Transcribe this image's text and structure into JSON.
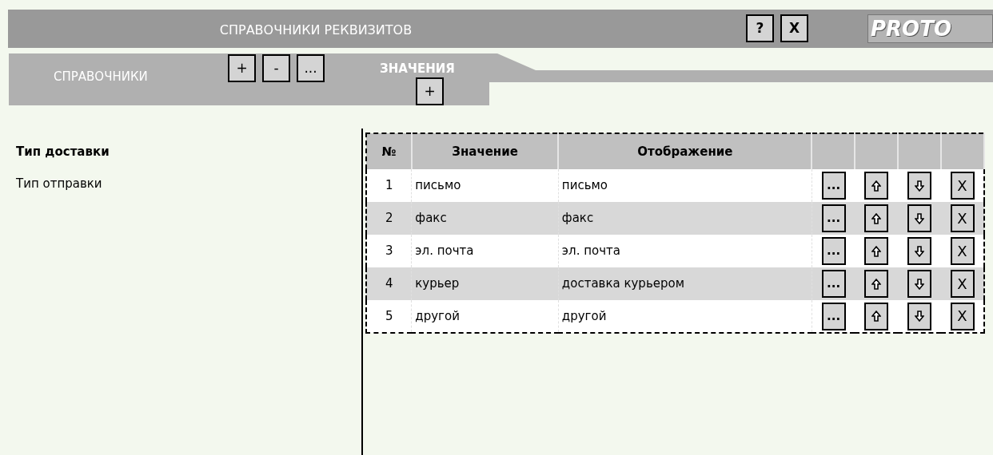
{
  "window": {
    "title": "СПРАВОЧНИКИ РЕКВИЗИТОВ",
    "buttons": [
      "?",
      "X"
    ],
    "logo": "PROTO"
  },
  "tabs": [
    {
      "label": "СПРАВОЧНИКИ",
      "selected": false,
      "buttons": [
        "+",
        "-",
        "..."
      ]
    },
    {
      "label": "ЗНАЧЕНИЯ",
      "selected": true,
      "buttons": [
        "+"
      ]
    }
  ],
  "sidebar": {
    "items": [
      {
        "label": "Тип доставки",
        "selected": true
      },
      {
        "label": "Тип отправки",
        "selected": false
      }
    ]
  },
  "table": {
    "columns": [
      "№",
      "Значение",
      "Отображение"
    ],
    "rows": [
      {
        "cells": [
          "1",
          "письмо",
          "письмо"
        ],
        "buttons": [
          "...",
          "X"
        ]
      },
      {
        "cells": [
          "2",
          "факс",
          "факс"
        ],
        "buttons": [
          "...",
          "X"
        ]
      },
      {
        "cells": [
          "3",
          "эл. почта",
          "эл. почта"
        ],
        "buttons": [
          "...",
          "X"
        ]
      },
      {
        "cells": [
          "4",
          "курьер",
          "доставка курьером"
        ],
        "buttons": [
          "...",
          "X"
        ]
      },
      {
        "cells": [
          "5",
          "другой",
          "другой"
        ],
        "buttons": [
          "...",
          "X"
        ]
      }
    ]
  }
}
